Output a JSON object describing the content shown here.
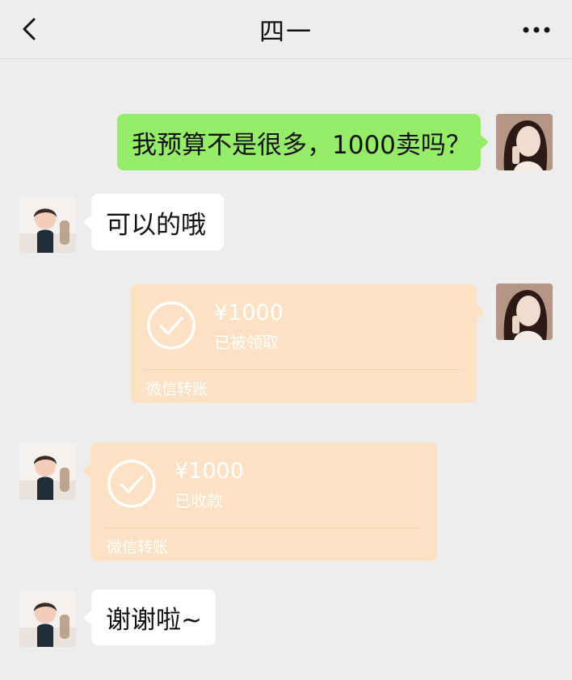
{
  "header": {
    "title": "四一"
  },
  "messages": {
    "m1": {
      "text": "我预算不是很多，1000卖吗？"
    },
    "m2": {
      "text": "可以的哦"
    },
    "t1": {
      "amount": "¥1000",
      "status": "已被领取",
      "footer": "微信转账"
    },
    "t2": {
      "amount": "¥1000",
      "status": "已收款",
      "footer": "微信转账"
    },
    "m3": {
      "text": "谢谢啦~"
    }
  },
  "colors": {
    "background": "#ededed",
    "sent_bubble": "#95ec69",
    "received_bubble": "#ffffff",
    "transfer_card": "#fce1c4"
  },
  "icons": {
    "back": "chevron-left-icon",
    "more": "more-dots-icon",
    "check": "check-circle-icon"
  }
}
